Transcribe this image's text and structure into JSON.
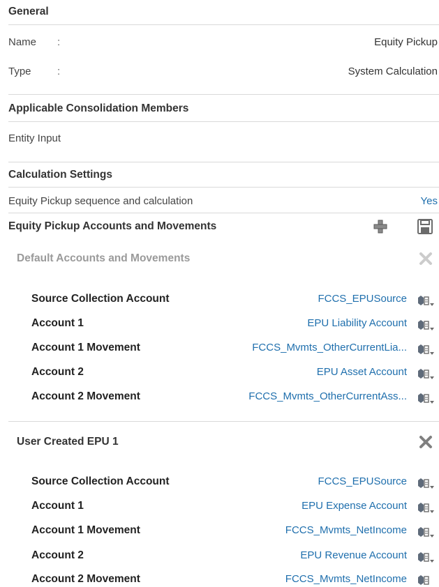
{
  "general": {
    "heading": "General",
    "name_label": "Name",
    "name_value": "Equity Pickup",
    "type_label": "Type",
    "type_value": "System Calculation",
    "separator": ":"
  },
  "members": {
    "heading": "Applicable Consolidation Members",
    "value": "Entity Input"
  },
  "calc": {
    "heading": "Calculation Settings",
    "setting_label": "Equity Pickup sequence and calculation",
    "setting_value": "Yes"
  },
  "epu": {
    "heading": "Equity Pickup Accounts and Movements",
    "groups": [
      {
        "title": "Default Accounts and Movements",
        "rows": [
          {
            "label": "Source Collection Account",
            "value": "FCCS_EPUSource"
          },
          {
            "label": "Account 1",
            "value": "EPU Liability Account"
          },
          {
            "label": "Account 1 Movement",
            "value": "FCCS_Mvmts_OtherCurrentLia..."
          },
          {
            "label": "Account 2",
            "value": "EPU Asset Account"
          },
          {
            "label": "Account 2 Movement",
            "value": "FCCS_Mvmts_OtherCurrentAss..."
          }
        ]
      },
      {
        "title": "User Created EPU 1",
        "rows": [
          {
            "label": "Source Collection Account",
            "value": "FCCS_EPUSource"
          },
          {
            "label": "Account 1",
            "value": "EPU Expense Account"
          },
          {
            "label": "Account 1 Movement",
            "value": "FCCS_Mvmts_NetIncome"
          },
          {
            "label": "Account 2",
            "value": "EPU Revenue Account"
          },
          {
            "label": "Account 2 Movement",
            "value": "FCCS_Mvmts_NetIncome"
          }
        ]
      }
    ]
  },
  "colors": {
    "link": "#1f6fad",
    "rule": "#d9d9d9",
    "muted": "#9a9a9a",
    "icon": "#6b6b6b"
  }
}
